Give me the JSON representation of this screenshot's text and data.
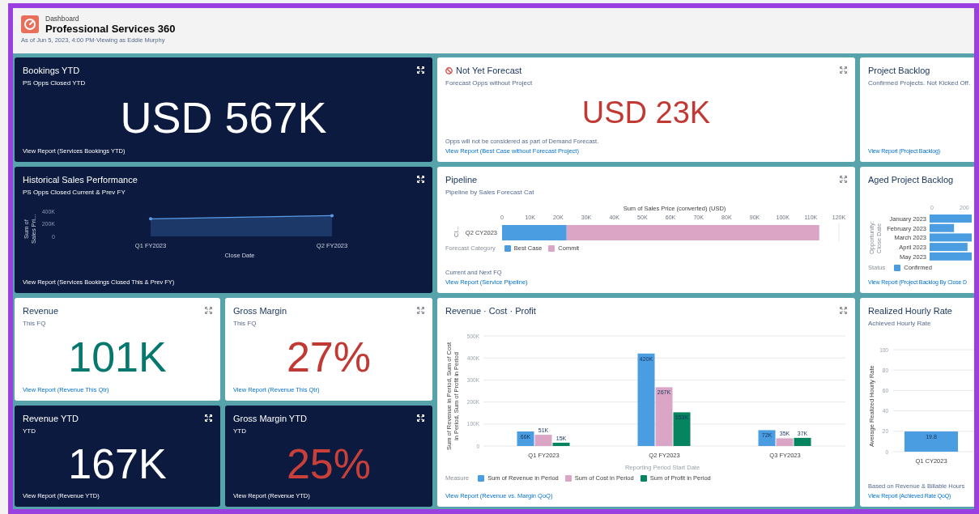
{
  "header": {
    "object_type": "Dashboard",
    "title": "Professional Services 360",
    "subtitle": "As of Jun 5, 2023, 4:00 PM·Viewing as Eddie Murphy"
  },
  "components": [
    {
      "kind": "metric",
      "dark": true,
      "title": "Bookings YTD",
      "subtitle": "PS Opps Closed YTD",
      "value": "USD 567K",
      "color": "#ffffff",
      "link": "View Report (Services Bookings YTD)",
      "expand_button": true
    },
    {
      "kind": "metric",
      "dark": false,
      "warning": true,
      "title": "Not Yet Forecast",
      "subtitle": "Forecast Opps without Project",
      "value": "USD 23K",
      "color": "#c23934",
      "note": "Opps will not be considered as part of Demand Forecast.",
      "link": "View Report (Best Case without Forecast Project)",
      "expand_button": true
    },
    {
      "kind": "metric",
      "dark": false,
      "title": "Project Backlog",
      "subtitle": "Confirmed Projects. Not Kicked Off.",
      "link": "View Report (Project Backlog)",
      "expand_button": false
    },
    {
      "kind": "chart",
      "dark": true,
      "title": "Historical Sales Performance",
      "subtitle": "PS Opps Closed Current & Prev FY",
      "link": "View Report (Services Bookings Closed This & Prev FY)",
      "expand_button": true,
      "chart_data": {
        "type": "area",
        "xlabel": "Close Date",
        "ylabel": "Sum of Sales Pri...",
        "categories": [
          "Q1 FY2023",
          "Q2 FY2023"
        ],
        "values": [
          280000,
          330000
        ],
        "ylim": [
          0,
          400000
        ],
        "yticks": [
          {
            "value": 0,
            "label": "0"
          },
          {
            "value": 200000,
            "label": "200K"
          },
          {
            "value": 400000,
            "label": "400K"
          }
        ]
      }
    },
    {
      "kind": "chart",
      "dark": false,
      "title": "Pipeline",
      "subtitle": "Pipeline by Sales Forecast Cat",
      "legend_title": "Forecast Category",
      "note": "Current and Next FQ",
      "link": "View Report (Service Pipeline)",
      "expand_button": true,
      "chart_data": {
        "type": "bar",
        "orientation": "horizontal",
        "stacked": true,
        "title": "Sum of Sales Price (converted) (USD)",
        "ylabel": "Cl...",
        "categories": [
          "Q2 CY2023"
        ],
        "series": [
          {
            "name": "Best Case",
            "color": "#4a9de0",
            "values": [
              23000
            ]
          },
          {
            "name": "Commit",
            "color": "#dba6c6",
            "values": [
              90000
            ]
          }
        ],
        "xlim": [
          0,
          120000
        ],
        "xticks": [
          {
            "value": 0,
            "label": "0"
          },
          {
            "value": 10000,
            "label": "10K"
          },
          {
            "value": 20000,
            "label": "20K"
          },
          {
            "value": 30000,
            "label": "30K"
          },
          {
            "value": 40000,
            "label": "40K"
          },
          {
            "value": 50000,
            "label": "50K"
          },
          {
            "value": 60000,
            "label": "60K"
          },
          {
            "value": 70000,
            "label": "70K"
          },
          {
            "value": 80000,
            "label": "80K"
          },
          {
            "value": 90000,
            "label": "90K"
          },
          {
            "value": 100000,
            "label": "100K"
          },
          {
            "value": 110000,
            "label": "110K"
          },
          {
            "value": 120000,
            "label": "120K"
          }
        ]
      }
    },
    {
      "kind": "backlog",
      "dark": false,
      "title": "Aged Project Backlog",
      "axis_title": "Opportunity: Close Date",
      "ticks": [
        "0",
        "200"
      ],
      "categories": [
        "January 2023",
        "February 2023",
        "March 2023",
        "April 2023",
        "May 2023"
      ],
      "legend_title": "Status",
      "legend": [
        {
          "name": "Confirmed",
          "color": "#4a9de0"
        }
      ],
      "link": "View Report (Project Backlog By Close D",
      "expand_button": false
    },
    {
      "kind": "metric",
      "dark": false,
      "title": "Revenue",
      "subtitle": "This FQ",
      "value": "101K",
      "color": "#04786e",
      "link": "View Report (Revenue This Qtr)",
      "expand_button": true
    },
    {
      "kind": "metric",
      "dark": false,
      "title": "Gross Margin",
      "subtitle": "This FQ",
      "value": "27%",
      "color": "#c23934",
      "link": "View Report (Revenue This Qtr)",
      "expand_button": true
    },
    {
      "kind": "metric",
      "dark": true,
      "title": "Revenue YTD",
      "subtitle": "YTD",
      "value": "167K",
      "color": "#ffffff",
      "link": "View Report (Revenue YTD)",
      "expand_button": true
    },
    {
      "kind": "metric",
      "dark": true,
      "title": "Gross Margin YTD",
      "subtitle": "YTD",
      "value": "25%",
      "color": "#c9403a",
      "link": "View Report (Revenue YTD)",
      "expand_button": true
    },
    {
      "kind": "chart",
      "dark": false,
      "title": "Revenue · Cost · Profit",
      "legend_title": "Measure",
      "link": "View Report (Revenue vs. Margin QoQ)",
      "expand_button": true,
      "chart_data": {
        "type": "bar",
        "grid": true,
        "xlabel": "Reporting Period Start Date",
        "ylabel": "Sum of Revenue in Period, Sum of Cost in Period, Sum of Profit in Period",
        "categories": [
          "Q1 FY2023",
          "Q2 FY2023",
          "Q3 FY2023"
        ],
        "series": [
          {
            "name": "Sum of Revenue in Period",
            "color": "#4a9de0",
            "values": [
              66000,
              420000,
              72000
            ],
            "value_labels": [
              "66K",
              "420K",
              "72K"
            ]
          },
          {
            "name": "Sum of Cost in Period",
            "color": "#dba6c6",
            "values": [
              51000,
              267000,
              35000
            ],
            "value_labels": [
              "51K",
              "267K",
              "35K"
            ]
          },
          {
            "name": "Sum of Profit in Period",
            "color": "#04845f",
            "values": [
              15000,
              153000,
              37000
            ],
            "value_labels": [
              "15K",
              "153K",
              "37K"
            ]
          }
        ],
        "ylim": [
          0,
          500000
        ],
        "yticks": [
          {
            "value": 0,
            "label": "0"
          },
          {
            "value": 100000,
            "label": "100K"
          },
          {
            "value": 200000,
            "label": "200K"
          },
          {
            "value": 300000,
            "label": "300K"
          },
          {
            "value": 400000,
            "label": "400K"
          },
          {
            "value": 500000,
            "label": "500K"
          }
        ]
      }
    },
    {
      "kind": "chart",
      "dark": false,
      "title": "Realized Hourly Rate",
      "subtitle": "Achieved Hourly Rate",
      "note": "Based on Revenue & Billable Hours",
      "link": "View Report (Achieved Rate QoQ)",
      "expand_button": false,
      "chart_data": {
        "type": "bar",
        "grid": true,
        "ylabel": "Average Realized Hourly Rate",
        "categories": [
          "Q1 CY2023"
        ],
        "values": [
          19.8
        ],
        "value_labels": [
          "19.8"
        ],
        "ylim": [
          0,
          100
        ],
        "yticks": [
          0,
          20,
          40,
          60,
          80,
          100
        ]
      }
    }
  ]
}
